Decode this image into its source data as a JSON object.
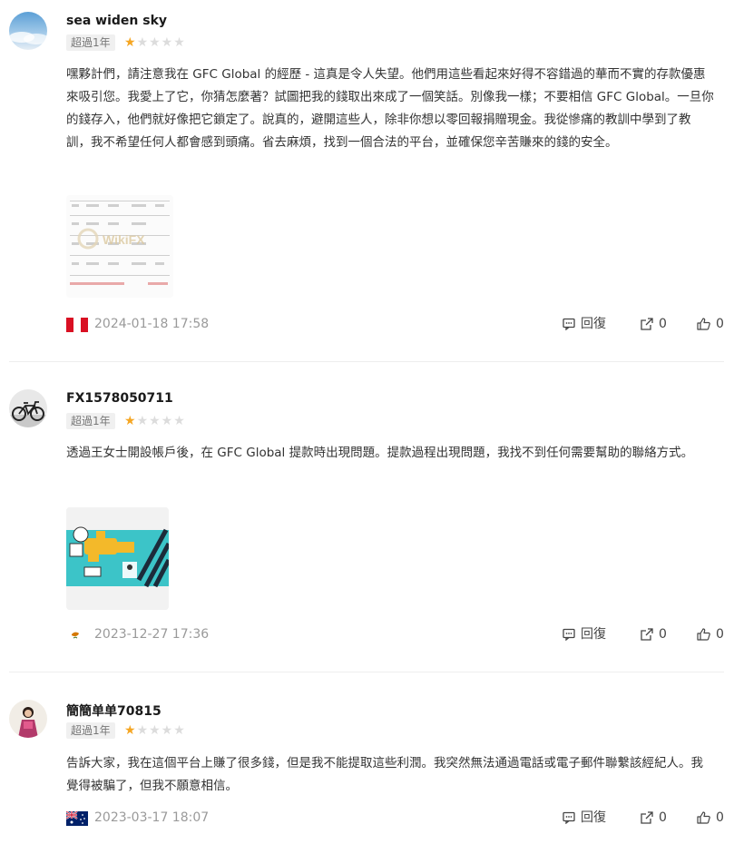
{
  "reviews": [
    {
      "username": "sea widen sky",
      "badge": "超過1年",
      "rating": 1,
      "text": "嘿夥計們，請注意我在 GFC Global 的經歷 - 這真是令人失望。他們用這些看起來好得不容錯過的華而不實的存款優惠來吸引您。我愛上了它，你猜怎麼著？試圖把我的錢取出來成了一個笑話。別像我一樣；不要相信 GFC Global。一旦你的錢存入，他們就好像把它鎖定了。說真的，避開這些人，除非你想以零回報捐贈現金。我從慘痛的教訓中學到了教訓，我不希望任何人都會感到頭痛。省去麻煩，找到一個合法的平台，並確保您辛苦賺來的錢的安全。",
      "date": "2024-01-18 17:58",
      "reply_label": "回復",
      "share_count": "0",
      "like_count": "0",
      "flag": "peru-flag",
      "watermark": "WikiFX"
    },
    {
      "username": "FX1578050711",
      "badge": "超過1年",
      "rating": 1,
      "text": "透過王女士開設帳戶後，在 GFC Global 提款時出現問題。提款過程出現問題，我找不到任何需要幫助的聯絡方式。",
      "date": "2023-12-27 17:36",
      "reply_label": "回復",
      "share_count": "0",
      "like_count": "0",
      "flag": "cyprus-flag"
    },
    {
      "username": "簡簡单单70815",
      "badge": "超過1年",
      "rating": 1,
      "text": "告訴大家，我在這個平台上賺了很多錢，但是我不能提取這些利潤。我突然無法通過電話或電子郵件聯繫該經紀人。我覺得被騙了，但我不願意相信。",
      "date": "2023-03-17 18:07",
      "reply_label": "回復",
      "share_count": "0",
      "like_count": "0",
      "flag": "australia-flag"
    }
  ],
  "colors": {
    "star": "#f5a623",
    "star_empty": "#dcdcdc",
    "date": "#9a9a9a",
    "badge_bg": "#f0f0f0"
  }
}
